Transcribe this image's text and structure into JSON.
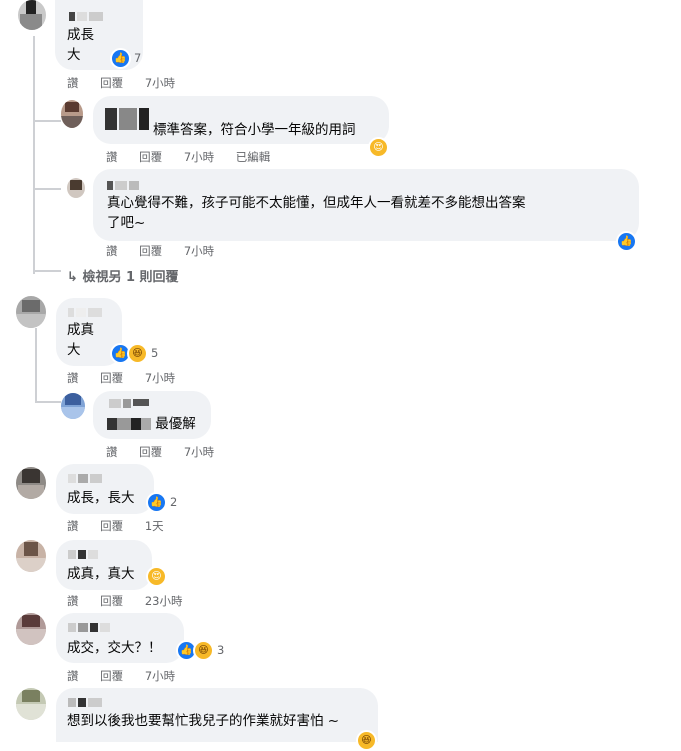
{
  "actions": {
    "like": "讚",
    "reply": "回覆",
    "edited": "已編輯"
  },
  "comments": [
    {
      "text_lines": [
        "成長",
        "大"
      ],
      "time": "7小時",
      "reaction_count": "7",
      "reactions": [
        "like-icon"
      ]
    },
    {
      "text": "標準答案，符合小學一年級的用詞",
      "time": "7小時",
      "edited": true,
      "reactions": [
        "care-icon"
      ]
    },
    {
      "text_lines": [
        "真心覺得不難，孩子可能不太能懂，但成年人一看就差不多能想出答案",
        "了吧~"
      ],
      "time": "7小時",
      "reactions": [
        "like-icon"
      ]
    },
    {
      "text_lines": [
        "成真",
        "大"
      ],
      "time": "7小時",
      "reaction_count": "5",
      "reactions": [
        "like-icon",
        "haha-icon"
      ]
    },
    {
      "text": "最優解",
      "time": "7小時"
    },
    {
      "text": "成長，長大",
      "time": "1天",
      "reaction_count": "2",
      "reactions": [
        "like-icon"
      ]
    },
    {
      "text": "成真，真大",
      "time": "23小時",
      "reactions": [
        "care-icon"
      ]
    },
    {
      "text": "成交，交大？！",
      "time": "7小時",
      "reaction_count": "3",
      "reactions": [
        "like-icon",
        "haha-icon"
      ]
    },
    {
      "text": "想到以後我也要幫忙我兒子的作業就好害怕 ~",
      "reactions": [
        "haha-icon"
      ]
    }
  ],
  "view_more_replies": "檢視另 1 則回覆",
  "colors": {
    "bubble": "#f0f2f5",
    "meta": "#65676b",
    "like": "#1877f2",
    "haha": "#f7b928"
  }
}
